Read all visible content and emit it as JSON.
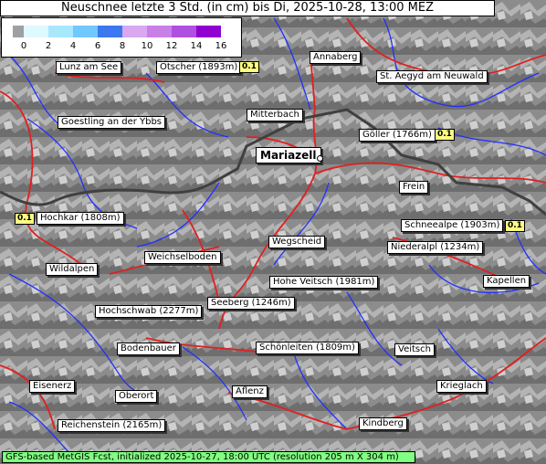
{
  "title": "Neuschnee letzte 3 Std. (in cm) bis Di, 2025-10-28, 13:00 MEZ",
  "legend": {
    "ticks": [
      "0",
      "2",
      "4",
      "6",
      "8",
      "10",
      "12",
      "14",
      "16"
    ],
    "colors": [
      "#a0a0a0",
      "#e0f8ff",
      "#a8e8ff",
      "#70c8ff",
      "#3c78f0",
      "#d8a8f0",
      "#c880e8",
      "#b050e0",
      "#9000d0"
    ]
  },
  "places": {
    "lunz": "Lunz am See",
    "oetscher": "Ötscher (1893m)",
    "annaberg": "Annaberg",
    "st_aegyd": "St. Aegyd am Neuwald",
    "goestling": "Goestling an der Ybbs",
    "mitterbach": "Mitterbach",
    "goeller": "Göller (1766m)",
    "mariazell": "Mariazell",
    "frein": "Frein",
    "hochkar": "Hochkar (1808m)",
    "schneealpe": "Schneealpe (1903m)",
    "wegscheid": "Wegscheid",
    "niederalpl": "Niederalpl (1234m)",
    "weichselboden": "Weichselboden",
    "wildalpen": "Wildalpen",
    "hohe_veitsch": "Hohe Veitsch (1981m)",
    "kapellen": "Kapellen",
    "seeberg": "Seeberg (1246m)",
    "hochschwab": "Hochschwab (2277m)",
    "bodenbauer": "Bodenbauer",
    "schoenleiten": "Schönleiten (1809m)",
    "veitsch": "Veitsch",
    "eisenerz": "Eisenerz",
    "oberort": "Oberort",
    "aflenz": "Aflenz",
    "krieglach": "Krieglach",
    "reichenstein": "Reichenstein (2165m)",
    "kindberg": "Kindberg"
  },
  "values": {
    "oetscher": "0.1",
    "goeller": "0.1",
    "hochkar": "0.1",
    "schneealpe": "0.1"
  },
  "footer": "GFS-based MetGIS Fcst, initialized 2025-10-27, 18:00 UTC  (resolution 205 m X 304 m)"
}
